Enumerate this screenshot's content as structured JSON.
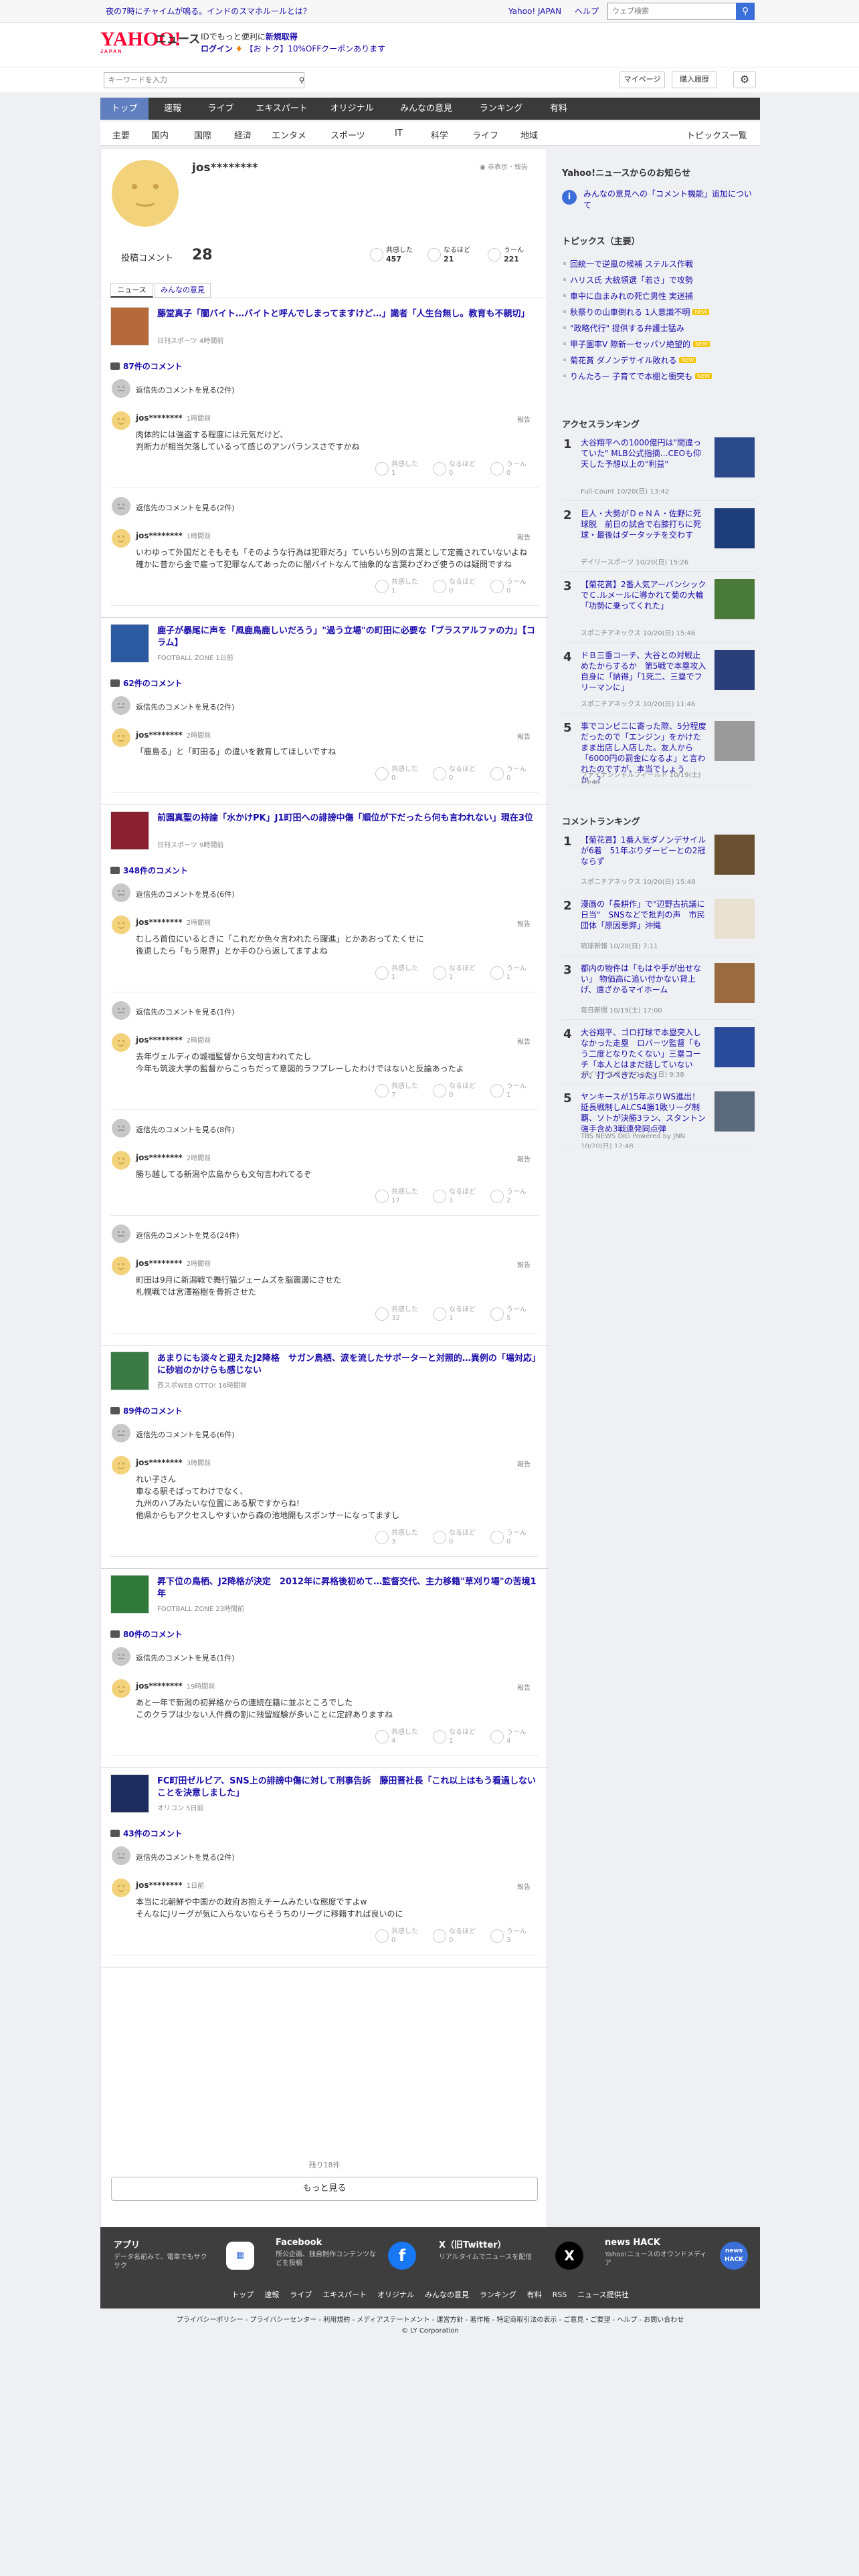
{
  "topbar": {
    "promo": "夜の7時にチャイムが鳴る。インドのスマホルールとは？",
    "links": [
      "Yahoo! JAPAN",
      "ヘルプ"
    ],
    "search_placeholder": "ウェブ検索"
  },
  "header": {
    "logo": "YAHOO!",
    "logo_sub": "JAPAN",
    "site": "ニュース",
    "line1_pre": "IDでもっと便利に",
    "line1_link": "新規取得",
    "line2_login": "ログイン",
    "line2_rest": "【お トク】10%OFFクーポンあります"
  },
  "search": {
    "placeholder": "キーワードを入力",
    "mypage": "マイページ",
    "history": "購入履歴"
  },
  "nav": [
    "トップ",
    "速報",
    "ライブ",
    "エキスパート",
    "オリジナル",
    "みんなの意見",
    "ランキング",
    "有料"
  ],
  "subnav": [
    "主要",
    "国内",
    "国際",
    "経済",
    "エンタメ",
    "スポーツ",
    "IT",
    "科学",
    "ライフ",
    "地域"
  ],
  "subnav_right": "トピックス一覧",
  "profile": {
    "name": "jos********",
    "hide_report": "非表示・報告",
    "count_label": "投稿コメント",
    "count": "28",
    "stats": [
      {
        "label": "共感した",
        "value": "457"
      },
      {
        "label": "なるほど",
        "value": "21"
      },
      {
        "label": "うーん",
        "value": "221"
      }
    ],
    "tabs": [
      "ニュース",
      "みんなの意見"
    ]
  },
  "articles": [
    {
      "title": "藤堂真子「闇バイト…バイトと呼んでしまってますけど…」識者「人生台無し。教育も不親切」",
      "src": "日刊スポーツ 4時間前",
      "count": "87件のコメント",
      "comments": [
        {
          "parent": "返信先のコメントを見る(2件)",
          "user": "jos********",
          "time": "1時間前",
          "body": "肉体的には強盗する程度には元気だけど、\n判断力が相当欠落しているって感じのアンバランスさですかね",
          "r": [
            "1",
            "0",
            "0"
          ]
        },
        {
          "parent": "返信先のコメントを見る(2件)",
          "user": "jos********",
          "time": "1時間前",
          "body": "いわゆって外国だとそもそも「そのような行為は犯罪だろ」ていちいち別の言葉として定義されていないよね\n確かに昔から金で雇って犯罪なんてあったのに闇バイトなんて抽象的な言葉わざわざ使うのは疑問ですね",
          "r": [
            "1",
            "0",
            "0"
          ]
        }
      ]
    },
    {
      "title": "鹿子が暴尾に声を「風鹿鳥鹿しいだろう」\"過う立場\"の町田に必要な「ブラスアルファの力」【コラム】",
      "src": "FOOTBALL ZONE 1日前",
      "count": "62件のコメント",
      "comments": [
        {
          "parent": "返信先のコメントを見る(2件)",
          "user": "jos********",
          "time": "2時間前",
          "body": "「鹿島る」と「町田る」の違いを教育してほしいですね",
          "r": [
            "0",
            "0",
            "0"
          ]
        }
      ]
    },
    {
      "title": "前園真聖の持論「水かけPK」J1町田への誹謗中傷「順位が下だったら何も言われない」現在3位",
      "src": "日刊スポーツ 9時間前",
      "count": "348件のコメント",
      "comments": [
        {
          "parent": "返信先のコメントを見る(6件)",
          "user": "jos********",
          "time": "2時間前",
          "body": "むしろ首位にいるときに「これだか色々言われたら躍進」とかあおってたくせに\n後退したら「もう限界」とか手のひら返してますよね",
          "r": [
            "1",
            "1",
            "1"
          ]
        },
        {
          "parent": "返信先のコメントを見る(1件)",
          "user": "jos********",
          "time": "2時間前",
          "body": "去年ヴェルディの城福監督から文句言われてたし\n今年も筑波大学の監督からこっちだって意図的ラフプレーしたわけではないと反論あったよ",
          "r": [
            "7",
            "0",
            "1"
          ]
        },
        {
          "parent": "返信先のコメントを見る(8件)",
          "user": "jos********",
          "time": "2時間前",
          "body": "勝ち越してる新潟や広島からも文句言われてるぞ",
          "r": [
            "17",
            "1",
            "2"
          ]
        },
        {
          "parent": "返信先のコメントを見る(24件)",
          "user": "jos********",
          "time": "2時間前",
          "body": "町田は9月に新潟戦で舞行猫ジェームズを脳震盪にさせた\n札幌戦では宮澤裕樹を骨折させた",
          "r": [
            "32",
            "1",
            "5"
          ]
        }
      ]
    },
    {
      "title": "あまりにも淡々と迎えたJ2降格　サガン鳥栖、涙を流したサポーターと対照的…異例の「場対応」に砂岩のかけらも感じない",
      "src": "西スポWEB OTTO! 16時間前",
      "count": "89件のコメント",
      "comments": [
        {
          "parent": "返信先のコメントを見る(6件)",
          "user": "jos********",
          "time": "3時間前",
          "body": "れい子さん\n車なる駅そばってわけでなく、\n九州のハブみたいな位置にある駅ですからね!\n他県からもアクセスしやすいから森の池地開もスポンサーになってますし",
          "r": [
            "3",
            "0",
            "0"
          ]
        }
      ]
    },
    {
      "title": "昇下位の鳥栖、J2降格が決定　2012年に昇格後初めて…監督交代、主力移籍\"草刈り場\"の苦境1年",
      "src": "FOOTBALL ZONE 23時間前",
      "count": "80件のコメント",
      "comments": [
        {
          "parent": "返信先のコメントを見る(1件)",
          "user": "jos********",
          "time": "19時間前",
          "body": "あと一年で新潟の初昇格からの連続在籍に並ぶところでした\nこのクラブは少ない人件費の割に残留縦験が多いことに定評ありますね",
          "r": [
            "4",
            "1",
            "4"
          ]
        }
      ]
    },
    {
      "title": "FC町田ゼルビア、SNS上の誹謗中傷に対して刑事告訴　藤田晋社長「これ以上はもう看過しないことを決意しました」",
      "src": "オリコン 5日前",
      "count": "43件のコメント",
      "comments": [
        {
          "parent": "返信先のコメントを見る(2件)",
          "user": "jos********",
          "time": "1日前",
          "body": "本当に北朝鮮や中国かの政府お抱えチームみたいな態度ですよw\nそんなにJリーグが気に入らないならそうちのリーグに移籍すれば良いのに",
          "r": [
            "0",
            "0",
            "3"
          ]
        }
      ]
    }
  ],
  "reactions_labels": [
    "共感した",
    "なるほど",
    "うーん"
  ],
  "report_label": "報告",
  "remaining": "残り18件",
  "more": "もっと見る",
  "side": {
    "notice_title": "Yahoo!ニュースからのお知らせ",
    "notice_text": "みんなの意見への「コメント機能」追加について",
    "topics_title": "トピックス（主要）",
    "topics": [
      {
        "t": "回統一で逆風の候補 ステルス作戦",
        "n": false
      },
      {
        "t": "ハリス氏 大統領選「若さ」で攻勢",
        "n": false
      },
      {
        "t": "車中に血まみれの死亡男性 実迷捕",
        "n": false
      },
      {
        "t": "秋祭りの山車倒れる 1人意識不明",
        "n": true
      },
      {
        "t": "\"政略代行\" 提供する弁護士猛み",
        "n": false
      },
      {
        "t": "甲子園率V 際新一セッパソ絶望的",
        "n": true
      },
      {
        "t": "菊花賞 ダノンデサイル敗れる",
        "n": true
      },
      {
        "t": "りんたろー 子育てで本棚と衝突も",
        "n": true
      }
    ],
    "access_title": "アクセスランキング",
    "access": [
      {
        "t": "大谷翔平への1000億円は\"間違っていた\" MLB公式指摘…CEOも仰天した予想以上の\"利益\"",
        "s": "Full-Count 10/20(日) 13:42"
      },
      {
        "t": "巨人・大勢がＤｅＮＡ・佐野に死球脱　前日の試合で右膝打ちに死球・最後はダータッチを交わす",
        "s": "デイリースポーツ 10/20(日) 15:26"
      },
      {
        "t": "【菊花賞】2番人気アーバンシックでＣ.ルメールに導かれて菊の大輪「功勢に乗ってくれた」",
        "s": "スポニチアネックス 10/20(日) 15:46"
      },
      {
        "t": "ドＢ三垂コーチ、大谷との対戦止めたからするか　第5戦で本塁攻入自身に「納得」「1死二、三塁でフリーマンに」",
        "s": "スポニチアネックス 10/20(日) 11:46"
      },
      {
        "t": "事でコンビニに寄った際、5分程度だったので「エンジン」をかけたまま出店し入店した。友人から「6000円の罰金になるよ」と言われたのですが、本当でしょうか…？",
        "s": "ファイナンシャルフィールド 10/19(土) 13:40"
      }
    ],
    "comment_title": "コメントランキング",
    "commentrank": [
      {
        "t": "【菊花賞】1番人気ダノンデサイルが6着　51年ぶりダービーとの2冠ならず",
        "s": "スポニチアネックス 10/20(日) 15:48"
      },
      {
        "t": "漫画の「長耕作」で\"辺野古抗議に日当\"　SNSなどで批判の声　市民団体「原因悪弊」沖縄",
        "s": "琉球新報 10/20(日) 7:11"
      },
      {
        "t": "都内の物件は「もはや手が出せない」 物価高に追い付かない貸上げ、遠ざかるマイホーム",
        "s": "毎日新聞 10/19(土) 17:00"
      },
      {
        "t": "大谷翔平、ゴロ打球で本塁突入しなかった走塁　ロバーツ監督「もう二度となりたくない」三塁コーチ「本人とはまだ話していないが、打つべきだった」",
        "s": "デイリースポーツ 10/20(日) 9:38"
      },
      {
        "t": "ヤンキースが15年ぶりWS進出！延長戦制しALCS4勝1敗リーグ制覇、ソトが決勝3ラン、スタントン強手含め3戦連発同点弾",
        "s": "TBS NEWS DIG Powered by JNN 10/20(日) 12:48"
      }
    ]
  },
  "footer": [
    {
      "h": "アプリ",
      "d": "データ名前みて、電車でもサクサク",
      "icon": "app-icon"
    },
    {
      "h": "Facebook",
      "d": "所公企画、独自制作コンテンツなどを投稿",
      "icon": "facebook-icon"
    },
    {
      "h": "X（旧Twitter）",
      "d": "リアルタイムでニュースを配信",
      "icon": "x-icon"
    },
    {
      "h": "news HACK",
      "d": "Yahoo!ニュースのオウンドメディア",
      "icon": "newshack-icon"
    }
  ],
  "footer_links": [
    "トップ",
    "速報",
    "ライブ",
    "エキスパート",
    "オリジナル",
    "みんなの意見",
    "ランキング",
    "有料",
    "RSS",
    "ニュース提供社"
  ],
  "legal": "プライバシーポリシー - プライバシーセンター - 利用規約 - メディアステートメント - 運営方針 - 著作権 - 特定商取引法の表示 - ご意見・ご要望 - ヘルプ - お問い合わせ",
  "copyright": "© LY Corporation"
}
